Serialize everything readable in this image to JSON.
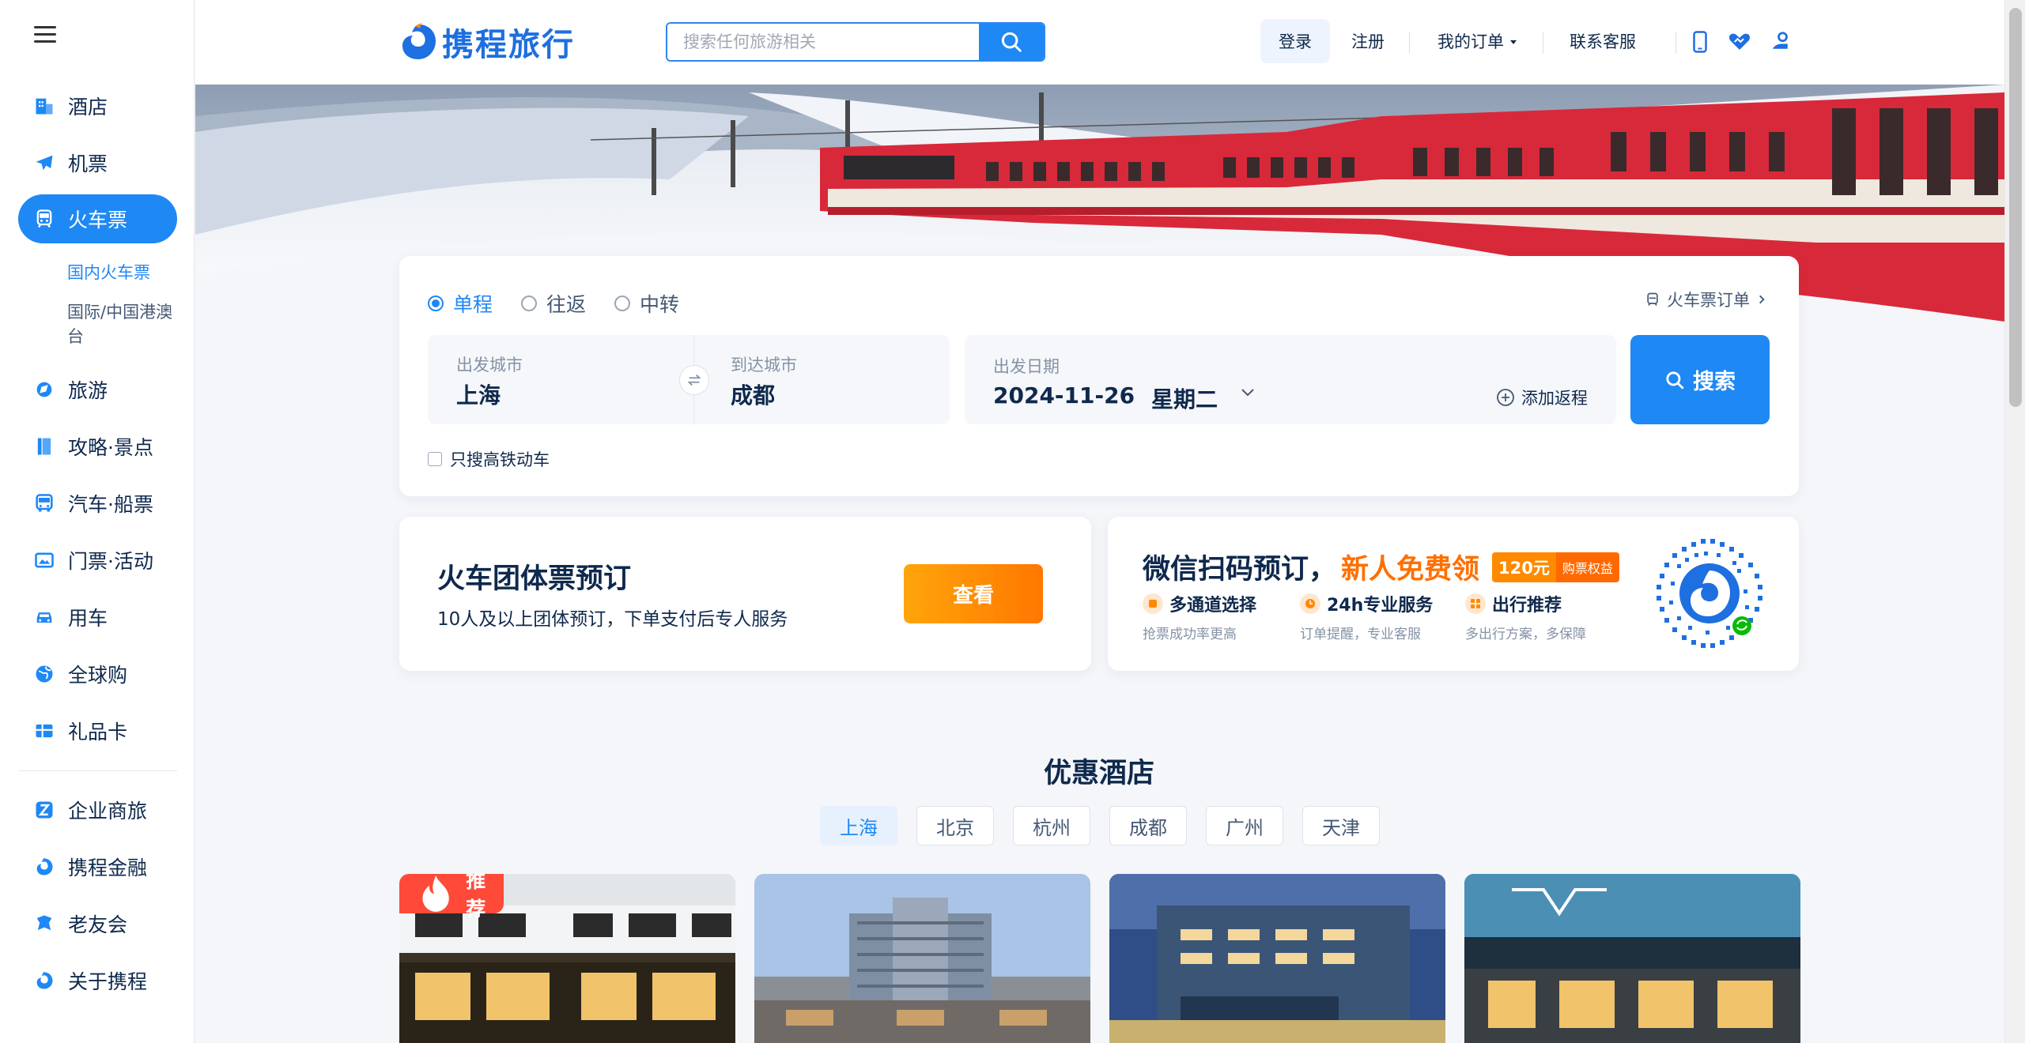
{
  "sidebar": {
    "items": [
      {
        "label": "酒店",
        "icon": "hotel-icon"
      },
      {
        "label": "机票",
        "icon": "plane-icon"
      },
      {
        "label": "火车票",
        "icon": "train-icon"
      },
      {
        "label": "旅游",
        "icon": "tour-icon"
      },
      {
        "label": "攻略·景点",
        "icon": "guide-icon"
      },
      {
        "label": "汽车·船票",
        "icon": "bus-icon"
      },
      {
        "label": "门票·活动",
        "icon": "ticket-icon"
      },
      {
        "label": "用车",
        "icon": "car-icon"
      },
      {
        "label": "全球购",
        "icon": "globe-icon"
      },
      {
        "label": "礼品卡",
        "icon": "gift-card-icon"
      },
      {
        "label": "企业商旅",
        "icon": "business-icon"
      },
      {
        "label": "携程金融",
        "icon": "finance-icon"
      },
      {
        "label": "老友会",
        "icon": "club-icon"
      },
      {
        "label": "关于携程",
        "icon": "about-icon"
      }
    ],
    "active_index": 2,
    "sub_items": [
      {
        "label": "国内火车票",
        "active": true
      },
      {
        "label": "国际/中国港澳",
        "label2": "台",
        "active": false
      }
    ]
  },
  "header": {
    "logo_text": "携程旅行",
    "search_placeholder": "搜索任何旅游相关",
    "login": "登录",
    "register": "注册",
    "my_orders": "我的订单",
    "service": "联系客服",
    "icons": [
      "mobile-icon",
      "heart-hands-icon",
      "user-service-icon"
    ]
  },
  "search_card": {
    "trip_types": [
      "单程",
      "往返",
      "中转"
    ],
    "selected_trip": "单程",
    "order_link": "火车票订单",
    "from_label": "出发城市",
    "from_value": "上海",
    "to_label": "到达城市",
    "to_value": "成都",
    "date_label": "出发日期",
    "date_value": "2024-11-26",
    "weekday": "星期二",
    "add_return": "添加返程",
    "search_button": "搜索",
    "highspeed_only": "只搜高铁动车",
    "highspeed_checked": false
  },
  "group_card": {
    "title": "火车团体票预订",
    "desc": "10人及以上团体预订，下单支付后专人服务",
    "button": "查看"
  },
  "wechat_card": {
    "title": "微信扫码预订，",
    "highlight": "新人免费领",
    "badge_amount": "120元",
    "badge_text": "购票权益",
    "features": [
      {
        "title": "多通道选择",
        "sub": "抢票成功率更高"
      },
      {
        "title": "24h专业服务",
        "sub": "订单提醒，专业客服"
      },
      {
        "title": "出行推荐",
        "sub": "多出行方案，多保障"
      }
    ]
  },
  "hotels": {
    "title": "优惠酒店",
    "cities": [
      "上海",
      "北京",
      "杭州",
      "成都",
      "广州",
      "天津"
    ],
    "selected_city": "上海",
    "recommend_tag": "推荐"
  },
  "colors": {
    "primary": "#1e88f5",
    "orange": "#ff7700",
    "text": "#0f294d"
  }
}
